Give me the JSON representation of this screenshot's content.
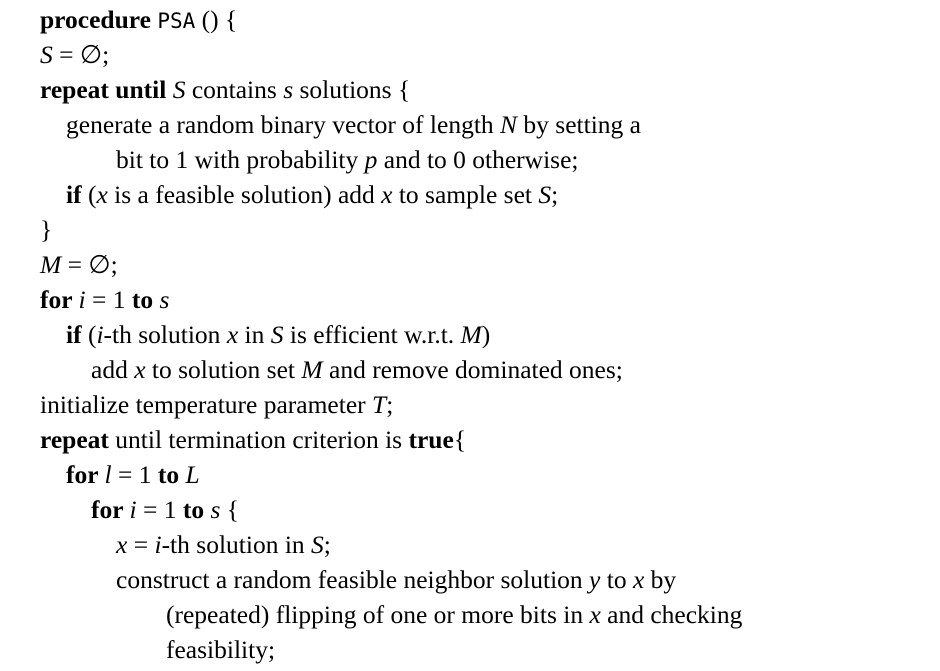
{
  "document": {
    "lines": [
      [
        {
          "t": "procedure ",
          "s": "b"
        },
        {
          "t": "PSA",
          "s": "c"
        },
        {
          "t": " () {",
          "s": "r"
        }
      ],
      [
        {
          "t": "S",
          "s": "m"
        },
        {
          "t": " = ∅;",
          "s": "r"
        }
      ],
      [
        {
          "t": "repeat until ",
          "s": "b"
        },
        {
          "t": "S",
          "s": "m"
        },
        {
          "t": " contains ",
          "s": "r"
        },
        {
          "t": "s",
          "s": "m"
        },
        {
          "t": " solutions {",
          "s": "r"
        }
      ],
      [
        {
          "t": "generate a random binary vector of length ",
          "s": "r"
        },
        {
          "t": "N",
          "s": "m"
        },
        {
          "t": " by setting a",
          "s": "r"
        }
      ],
      [
        {
          "t": "bit to 1 with probability ",
          "s": "r"
        },
        {
          "t": "p",
          "s": "m"
        },
        {
          "t": " and to 0 otherwise;",
          "s": "r"
        }
      ],
      [
        {
          "t": "if",
          "s": "b"
        },
        {
          "t": " (",
          "s": "r"
        },
        {
          "t": "x",
          "s": "m"
        },
        {
          "t": " is a feasible solution) add ",
          "s": "r"
        },
        {
          "t": "x",
          "s": "m"
        },
        {
          "t": " to sample set ",
          "s": "r"
        },
        {
          "t": "S",
          "s": "m"
        },
        {
          "t": ";",
          "s": "r"
        }
      ],
      [
        {
          "t": "}",
          "s": "r"
        }
      ],
      [
        {
          "t": "M",
          "s": "m"
        },
        {
          "t": " = ∅;",
          "s": "r"
        }
      ],
      [
        {
          "t": "for ",
          "s": "b"
        },
        {
          "t": "i",
          "s": "m"
        },
        {
          "t": " = 1 ",
          "s": "r"
        },
        {
          "t": "to ",
          "s": "b"
        },
        {
          "t": "s",
          "s": "m"
        }
      ],
      [
        {
          "t": "if",
          "s": "b"
        },
        {
          "t": " (",
          "s": "r"
        },
        {
          "t": "i",
          "s": "m"
        },
        {
          "t": "-th solution ",
          "s": "r"
        },
        {
          "t": "x",
          "s": "m"
        },
        {
          "t": " in ",
          "s": "r"
        },
        {
          "t": "S",
          "s": "m"
        },
        {
          "t": " is efficient w.r.t. ",
          "s": "r"
        },
        {
          "t": "M",
          "s": "m"
        },
        {
          "t": ")",
          "s": "r"
        }
      ],
      [
        {
          "t": "add ",
          "s": "r"
        },
        {
          "t": "x",
          "s": "m"
        },
        {
          "t": " to solution set ",
          "s": "r"
        },
        {
          "t": "M",
          "s": "m"
        },
        {
          "t": " and remove dominated ones;",
          "s": "r"
        }
      ],
      [
        {
          "t": "initialize temperature parameter ",
          "s": "r"
        },
        {
          "t": "T",
          "s": "m"
        },
        {
          "t": ";",
          "s": "r"
        }
      ],
      [
        {
          "t": "repeat",
          "s": "b"
        },
        {
          "t": " until termination criterion is ",
          "s": "r"
        },
        {
          "t": "true",
          "s": "b"
        },
        {
          "t": "{",
          "s": "r"
        }
      ],
      [
        {
          "t": "for ",
          "s": "b"
        },
        {
          "t": "l",
          "s": "m"
        },
        {
          "t": " = 1 ",
          "s": "r"
        },
        {
          "t": "to ",
          "s": "b"
        },
        {
          "t": "L",
          "s": "m"
        }
      ],
      [
        {
          "t": "for ",
          "s": "b"
        },
        {
          "t": "i",
          "s": "m"
        },
        {
          "t": " = 1 ",
          "s": "r"
        },
        {
          "t": "to ",
          "s": "b"
        },
        {
          "t": "s",
          "s": "m"
        },
        {
          "t": " {",
          "s": "r"
        }
      ],
      [
        {
          "t": "x",
          "s": "m"
        },
        {
          "t": " = ",
          "s": "r"
        },
        {
          "t": "i",
          "s": "m"
        },
        {
          "t": "-th solution in ",
          "s": "r"
        },
        {
          "t": "S",
          "s": "m"
        },
        {
          "t": ";",
          "s": "r"
        }
      ],
      [
        {
          "t": "construct a random feasible neighbor solution ",
          "s": "r"
        },
        {
          "t": "y",
          "s": "m"
        },
        {
          "t": " to ",
          "s": "r"
        },
        {
          "t": "x",
          "s": "m"
        },
        {
          "t": " by",
          "s": "r"
        }
      ],
      [
        {
          "t": "(repeated) flipping of one or more bits in ",
          "s": "r"
        },
        {
          "t": "x",
          "s": "m"
        },
        {
          "t": " and checking",
          "s": "r"
        }
      ],
      [
        {
          "t": "feasibility;",
          "s": "r"
        }
      ]
    ]
  }
}
